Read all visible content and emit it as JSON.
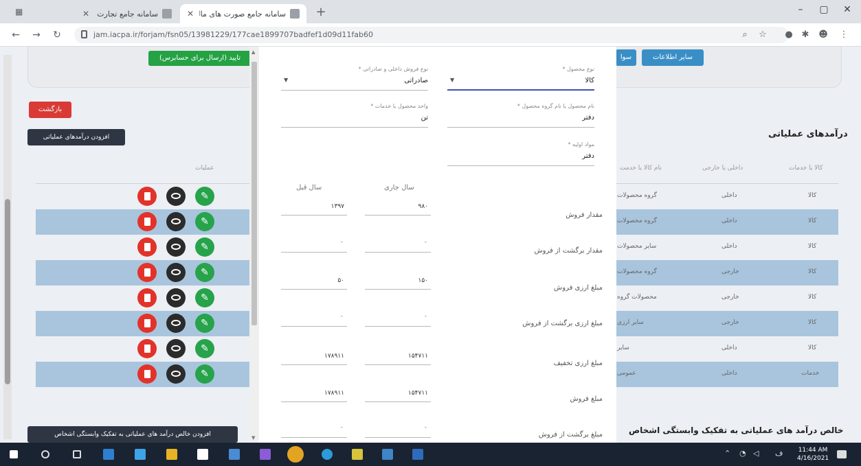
{
  "browser": {
    "tabs": [
      {
        "title": "سامانه جامع تجارت",
        "active": false
      },
      {
        "title": "سامانه جامع صورت های مالی",
        "active": true
      }
    ],
    "url": "jam.iacpa.ir/forjam/fsn05/13981229/177cae1899707badfef1d09d11fab60"
  },
  "page": {
    "top_buttons": {
      "send": "تایید (ارسال برای حسابرس)",
      "other_info": "سایر اطلاعات",
      "partial": "سوا"
    },
    "back_button": "بازگشت",
    "add_income_button": "افزودن درآمدهای عملیاتی",
    "section_title": "درآمدهای عملیاتی",
    "table": {
      "headers": {
        "actions": "عملیات",
        "product": "نام کالا یا خدمت",
        "type": "داخلی یا خارجی",
        "kind": "کالا یا خدمات"
      },
      "rows": [
        {
          "product": "گروه محصولات",
          "type": "داخلی",
          "kind": "کالا"
        },
        {
          "product": "گروه محصولات",
          "type": "داخلی",
          "kind": "کالا"
        },
        {
          "product": "سایر محصولات",
          "type": "داخلی",
          "kind": "کالا"
        },
        {
          "product": "گروه محصولات",
          "type": "خارجی",
          "kind": "کالا"
        },
        {
          "product": "محصولات گروه",
          "type": "خارجی",
          "kind": "کالا"
        },
        {
          "product": "سایر ارزی",
          "type": "خارجی",
          "kind": "کالا"
        },
        {
          "product": "سایر",
          "type": "داخلی",
          "kind": "کالا"
        },
        {
          "product": "عمومی",
          "type": "داخلی",
          "kind": "خدمات"
        }
      ]
    },
    "bottom_button": "افزودن خالص درآمد های عملیاتی به تفکیک وابستگی اشخاص",
    "bottom_title": "خالص درآمد های عملیاتی به تفکیک وابستگی اشخاص"
  },
  "modal": {
    "fields": {
      "product_type": {
        "label": "نوع محصول *",
        "value": "کالا"
      },
      "sales_type": {
        "label": "نوع فروش داخلی و صادراتی *",
        "value": "صادراتی"
      },
      "product_name": {
        "label": "نام محصول یا نام گروه محصول *",
        "value": "دفتر"
      },
      "unit": {
        "label": "واحد محصول یا خدمات *",
        "value": "تن"
      },
      "other": {
        "label": "مواد اولیه *",
        "value": "دفتر"
      }
    },
    "columns": {
      "current": "سال جاری",
      "previous": "سال قبل"
    },
    "rows": [
      {
        "label": "مقدار فروش",
        "current": "۹۸۰",
        "previous": "۱۳۹۷"
      },
      {
        "label": "مقدار برگشت از فروش",
        "current": "",
        "previous": ""
      },
      {
        "label": "مبلغ ارزی فروش",
        "current": "۱۵۰",
        "previous": "۵۰"
      },
      {
        "label": "مبلغ ارزی برگشت از فروش",
        "current": "",
        "previous": ""
      },
      {
        "label": "مبلغ ارزی تخفیف",
        "current": "۱۵۴۷۱۱",
        "previous": "۱۷۸۹۱۱"
      },
      {
        "label": "مبلغ فروش",
        "current": "۱۵۴۷۱۱",
        "previous": "۱۷۸۹۱۱"
      },
      {
        "label": "مبلغ برگشت از فروش",
        "current": "",
        "previous": ""
      }
    ]
  },
  "taskbar": {
    "time": "11:44 AM",
    "date": "4/16/2021"
  }
}
